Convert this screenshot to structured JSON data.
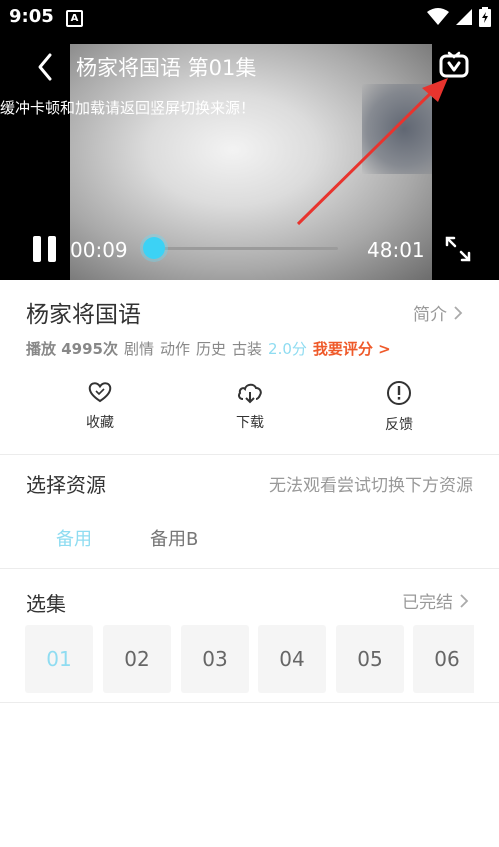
{
  "status_bar": {
    "time": "9:05",
    "notification_icon": "A"
  },
  "player": {
    "title": "杨家将国语 第01集",
    "buffer_tip": "缓冲卡顿和加载请返回竖屏切换来源！",
    "current_time": "00:09",
    "total_time": "48:01",
    "progress_fraction": 0.003
  },
  "show": {
    "title": "杨家将国语",
    "intro_label": "简介",
    "plays": "播放 4995次",
    "tags": [
      "剧情",
      "动作",
      "历史",
      "古装"
    ],
    "score": "2.0分",
    "rate_label": "我要评分"
  },
  "actions": [
    {
      "label": "收藏",
      "icon": "heart-icon"
    },
    {
      "label": "下载",
      "icon": "cloud-download-icon"
    },
    {
      "label": "反馈",
      "icon": "alert-icon"
    }
  ],
  "sources": {
    "title": "选择资源",
    "hint": "无法观看尝试切换下方资源",
    "tabs": [
      "备用",
      "备用B"
    ]
  },
  "episodes": {
    "title": "选集",
    "status": "已完结",
    "items": [
      "01",
      "02",
      "03",
      "04",
      "05",
      "06"
    ]
  },
  "colors": {
    "accent": "#3cd2f5",
    "rate": "#ef5a2a",
    "arrow": "#e8342e"
  }
}
